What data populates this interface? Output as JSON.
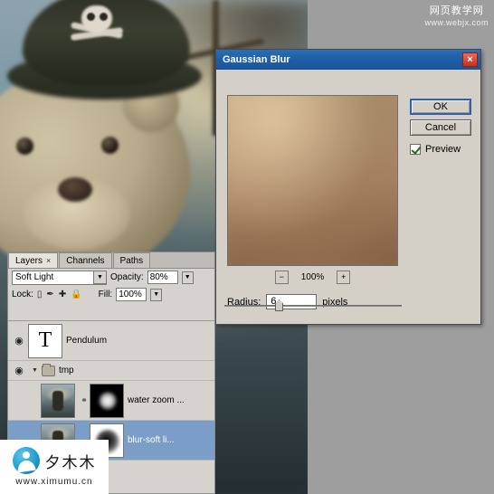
{
  "photo": {
    "alt_name": "pirate-teddy-bear-photo"
  },
  "watermark_top_right": {
    "line1": "网页教学网",
    "line2": "www.webjx.com"
  },
  "watermark_bottom_left": {
    "text": "夕木木",
    "url": "www.ximumu.cn",
    "logo": "penguin-logo"
  },
  "layers_panel": {
    "tabs": [
      {
        "label": "Layers",
        "close": "×",
        "active": true
      },
      {
        "label": "Channels",
        "active": false
      },
      {
        "label": "Paths",
        "active": false
      }
    ],
    "blend_mode": "Soft Light",
    "opacity_label": "Opacity:",
    "opacity_value": "80%",
    "lock_label": "Lock:",
    "fill_label": "Fill:",
    "fill_value": "100%",
    "dropdown_arrow": "▼",
    "eye": "◉",
    "rows": [
      {
        "type": "layer",
        "visible": true,
        "eye": "◉",
        "thumb": "text-T",
        "thumb_text": "T",
        "name": "Pendulum",
        "selected": false
      },
      {
        "type": "group",
        "visible": true,
        "eye": "◉",
        "triangle": "▼",
        "name": "tmp",
        "selected": false
      },
      {
        "type": "layer",
        "visible": false,
        "eye": "",
        "thumb": "photo-thumb",
        "mask": "mask-dark",
        "link": "⚭",
        "name": "water zoom ...",
        "selected": false
      },
      {
        "type": "layer",
        "visible": false,
        "eye": "",
        "thumb": "photo-thumb",
        "mask": "mask-light",
        "name": "blur-soft li...",
        "selected": true
      }
    ]
  },
  "dialog": {
    "title": "Gaussian Blur",
    "close_label": "×",
    "ok_label": "OK",
    "cancel_label": "Cancel",
    "preview_label": "Preview",
    "preview_checked": true,
    "zoom_out": "−",
    "zoom_in": "+",
    "zoom_level": "100%",
    "radius_label": "Radius:",
    "radius_value": "6",
    "radius_units": "pixels",
    "slider_position_pct": 28
  },
  "colors": {
    "title_bar_blue": "#1f5fa8",
    "dialog_face": "#d4d0c8",
    "selection_blue": "#7a9ec8",
    "close_red": "#c9301c",
    "desktop_grey": "#9e9e9e"
  }
}
